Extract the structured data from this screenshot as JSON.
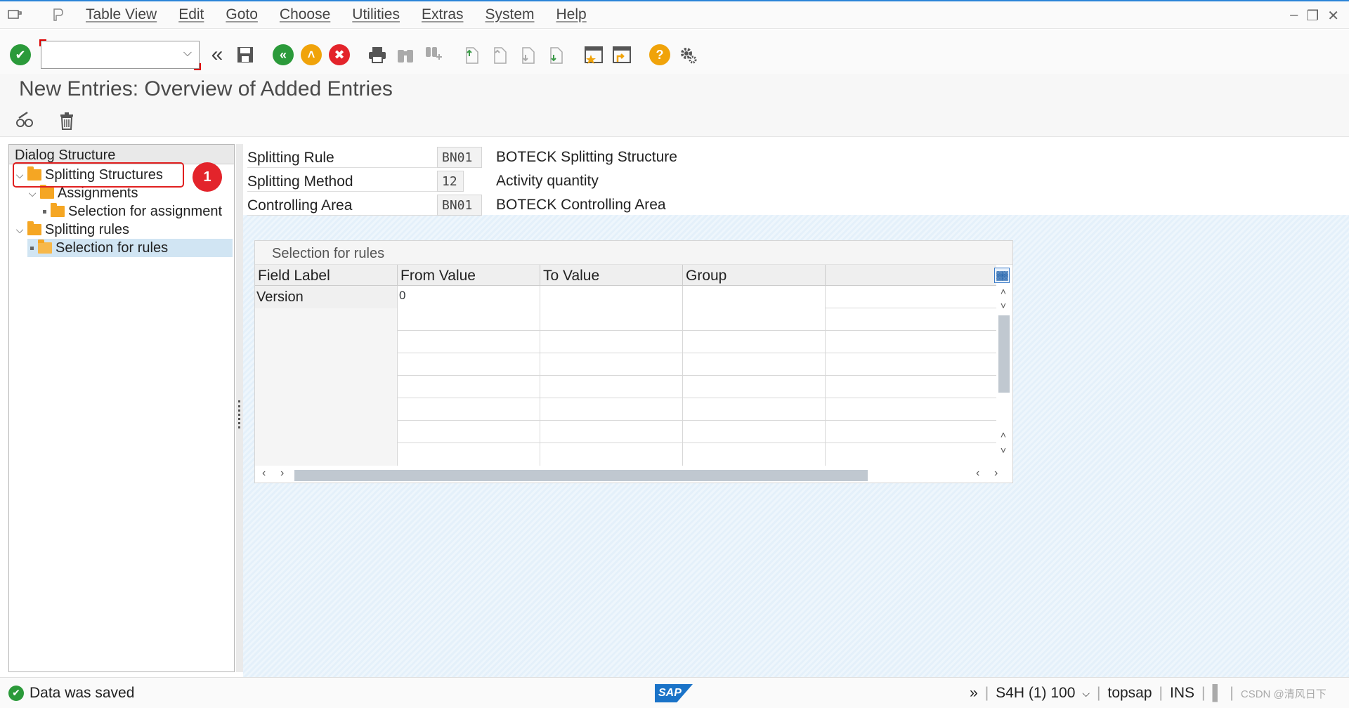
{
  "menubar": {
    "items": [
      "Table View",
      "Edit",
      "Goto",
      "Choose",
      "Utilities",
      "Extras",
      "System",
      "Help"
    ]
  },
  "toolbar": {
    "command_value": ""
  },
  "page_title": "New Entries: Overview of Added Entries",
  "tree": {
    "header": "Dialog Structure",
    "items": [
      {
        "label": "Splitting Structures"
      },
      {
        "label": "Assignments"
      },
      {
        "label": "Selection for assignment"
      },
      {
        "label": "Splitting rules"
      },
      {
        "label": "Selection for rules"
      }
    ],
    "annotation_badge": "1"
  },
  "header_fields": [
    {
      "label": "Splitting Rule",
      "value": "BN01",
      "desc": "BOTECK Splitting Structure"
    },
    {
      "label": "Splitting Method",
      "value": "12",
      "desc": "Activity quantity"
    },
    {
      "label": "Controlling Area",
      "value": "BN01",
      "desc": "BOTECK Controlling Area"
    }
  ],
  "table": {
    "title": "Selection for rules",
    "columns": [
      "Field Label",
      "From Value",
      "To Value",
      "Group"
    ],
    "rows": [
      {
        "label": "Version",
        "from": "0",
        "to": "",
        "group": ""
      }
    ]
  },
  "status": {
    "message": "Data was saved",
    "system": "S4H (1) 100",
    "host": "topsap",
    "mode": "INS",
    "watermark": "CSDN @清风日下"
  },
  "colors": {
    "accent": "#2a84d8",
    "ok_green": "#2b9a3a",
    "cancel_red": "#e3242b",
    "up_orange": "#f0a30a",
    "selected_row": "#d1e5f3"
  }
}
